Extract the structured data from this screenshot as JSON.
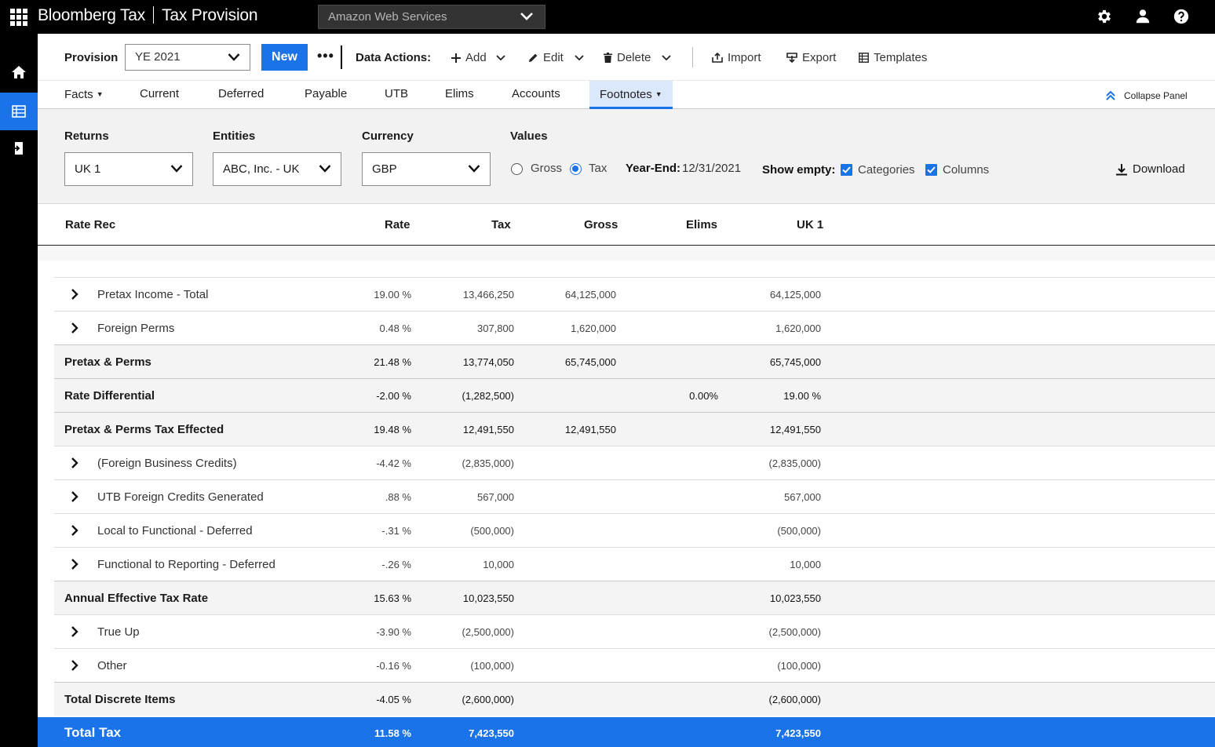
{
  "app": {
    "brand": "Bloomberg Tax",
    "product": "Tax Provision",
    "org_selector": "Amazon Web Services"
  },
  "toolbar": {
    "provision_label": "Provision",
    "provision_value": "YE 2021",
    "new_label": "New",
    "more_label": "•••",
    "data_actions_label": "Data Actions:",
    "add_label": "Add",
    "edit_label": "Edit",
    "delete_label": "Delete",
    "import_label": "Import",
    "export_label": "Export",
    "templates_label": "Templates"
  },
  "tabs": [
    {
      "label": "Facts",
      "dropdown": true
    },
    {
      "label": "Current"
    },
    {
      "label": "Deferred"
    },
    {
      "label": "Payable"
    },
    {
      "label": "UTB"
    },
    {
      "label": "Elims"
    },
    {
      "label": "Accounts"
    },
    {
      "label": "Footnotes",
      "dropdown": true,
      "active": true
    }
  ],
  "collapse_panel_label": "Collapse Panel",
  "filters": {
    "returns_label": "Returns",
    "returns_value": "UK 1",
    "entities_label": "Entities",
    "entities_value": "ABC, Inc. - UK",
    "currency_label": "Currency",
    "currency_value": "GBP",
    "values_label": "Values",
    "gross_label": "Gross",
    "tax_label": "Tax",
    "values_selected": "Tax",
    "year_end_label": "Year-End:",
    "year_end_value": "12/31/2021",
    "show_empty_label": "Show empty:",
    "categories_label": "Categories",
    "columns_label": "Columns",
    "categories_checked": true,
    "columns_checked": true,
    "download_label": "Download"
  },
  "table": {
    "columns": [
      "Rate Rec",
      "Rate",
      "Tax",
      "Gross",
      "Elims",
      "UK 1"
    ],
    "rows": [
      {
        "type": "sub",
        "label": "Pretax Income - Total",
        "rate": "19.00 %",
        "tax": "13,466,250",
        "gross": "64,125,000",
        "elims": "",
        "uk1": "64,125,000"
      },
      {
        "type": "sub",
        "label": "Foreign Perms",
        "rate": "0.48 %",
        "tax": "307,800",
        "gross": "1,620,000",
        "elims": "",
        "uk1": "1,620,000"
      },
      {
        "type": "tot",
        "label": "Pretax & Perms",
        "rate": "21.48 %",
        "tax": "13,774,050",
        "gross": "65,745,000",
        "elims": "",
        "uk1": "65,745,000"
      },
      {
        "type": "tot",
        "label": "Rate Differential",
        "rate": "-2.00 %",
        "tax": "(1,282,500)",
        "gross": "",
        "elims": "0.00%",
        "uk1": "19.00 %"
      },
      {
        "type": "tot",
        "label": "Pretax & Perms Tax Effected",
        "rate": "19.48 %",
        "tax": "12,491,550",
        "gross": "12,491,550",
        "elims": "",
        "uk1": "12,491,550"
      },
      {
        "type": "sub",
        "label": "(Foreign Business Credits)",
        "rate": "-4.42 %",
        "tax": "(2,835,000)",
        "gross": "",
        "elims": "",
        "uk1": "(2,835,000)"
      },
      {
        "type": "sub",
        "label": "UTB Foreign Credits Generated",
        "rate": ".88 %",
        "tax": "567,000",
        "gross": "",
        "elims": "",
        "uk1": "567,000"
      },
      {
        "type": "sub",
        "label": "Local to Functional - Deferred",
        "rate": "-.31 %",
        "tax": "(500,000)",
        "gross": "",
        "elims": "",
        "uk1": "(500,000)"
      },
      {
        "type": "sub",
        "label": "Functional to Reporting - Deferred",
        "rate": "-.26 %",
        "tax": "10,000",
        "gross": "",
        "elims": "",
        "uk1": "10,000"
      },
      {
        "type": "tot",
        "label": "Annual Effective Tax Rate",
        "rate": "15.63 %",
        "tax": "10,023,550",
        "gross": "",
        "elims": "",
        "uk1": "10,023,550"
      },
      {
        "type": "sub",
        "label": "True Up",
        "rate": "-3.90 %",
        "tax": "(2,500,000)",
        "gross": "",
        "elims": "",
        "uk1": "(2,500,000)"
      },
      {
        "type": "sub",
        "label": "Other",
        "rate": "-0.16 %",
        "tax": "(100,000)",
        "gross": "",
        "elims": "",
        "uk1": "(100,000)"
      },
      {
        "type": "tot",
        "label": "Total Discrete Items",
        "rate": "-4.05 %",
        "tax": "(2,600,000)",
        "gross": "",
        "elims": "",
        "uk1": "(2,600,000)"
      }
    ],
    "total": {
      "label": "Total  Tax",
      "rate": "11.58 %",
      "tax": "7,423,550",
      "uk1": "7,423,550"
    }
  },
  "colors": {
    "accent": "#1a73e8",
    "topbar": "#000000",
    "panel": "#f2f2f2"
  }
}
